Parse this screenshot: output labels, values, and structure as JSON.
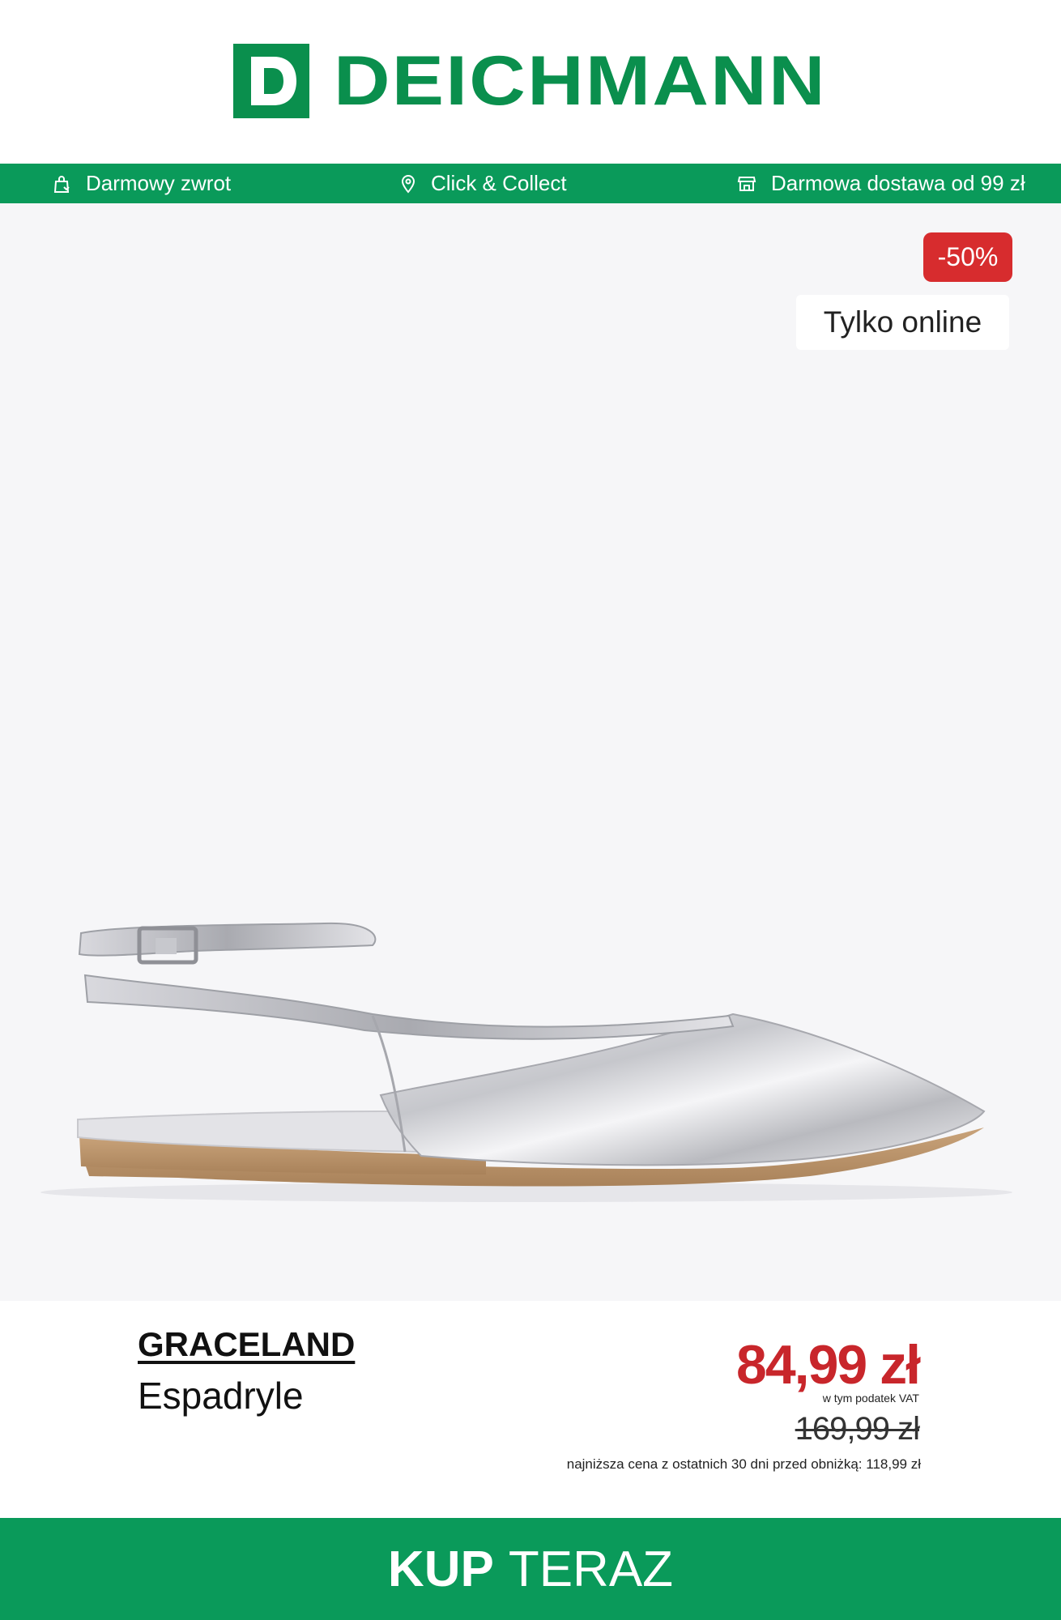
{
  "brand_logo": {
    "text": "DEICHMANN",
    "color": "#0a8f4d"
  },
  "usp_bar": {
    "items": [
      {
        "icon": "return-bag-icon",
        "label": "Darmowy zwrot"
      },
      {
        "icon": "location-pin-icon",
        "label": "Click & Collect"
      },
      {
        "icon": "store-icon",
        "label": "Darmowa dostawa od 99 zł"
      }
    ],
    "color": "#0a9a5a"
  },
  "product": {
    "discount_badge": "-50%",
    "online_badge": "Tylko online",
    "brand": "GRACELAND",
    "category": "Espadryle",
    "price": "84,99 zł",
    "vat_note": "w tym podatek VAT",
    "old_price": "169,99 zł",
    "lowest_price_note": "najniższa cena z ostatnich 30 dni przed obniżką: 118,99  zł",
    "image": "silver-slingback-flat-shoe"
  },
  "cta": {
    "bold": "KUP",
    "rest": "TERAZ"
  },
  "colors": {
    "green": "#0a9a5a",
    "red": "#d72c2e",
    "price_red": "#c8262b"
  }
}
